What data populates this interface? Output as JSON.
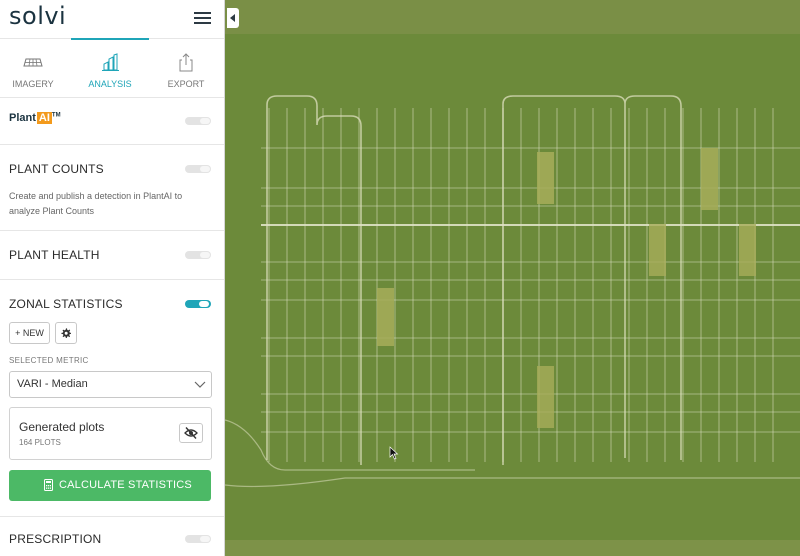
{
  "app": {
    "logo": "solvi"
  },
  "tabs": [
    {
      "label": "IMAGERY",
      "icon": "imagery-icon",
      "active": false
    },
    {
      "label": "ANALYSIS",
      "icon": "analysis-icon",
      "active": true
    },
    {
      "label": "EXPORT",
      "icon": "export-icon",
      "active": false
    }
  ],
  "plantai": {
    "brand": "Plant",
    "brand_ai": "AI",
    "trademark": "TM",
    "enabled": false
  },
  "plant_counts": {
    "title": "PLANT COUNTS",
    "description": "Create and publish a detection in PlantAI to analyze Plant Counts",
    "enabled": false
  },
  "plant_health": {
    "title": "PLANT HEALTH",
    "enabled": false
  },
  "zonal_statistics": {
    "title": "ZONAL STATISTICS",
    "enabled": true,
    "new_label": "+ NEW",
    "metric_label": "SELECTED METRIC",
    "metric_value": "VARI - Median",
    "plots_title": "Generated plots",
    "plots_count": "164 PLOTS",
    "calculate_label": "CALCULATE STATISTICS"
  },
  "prescription": {
    "title": "PRESCRIPTION",
    "enabled": false
  },
  "colors": {
    "accent": "#1fa5b8",
    "primary_button": "#4cb966",
    "brand_ai": "#f39a1c",
    "field": "#6f8a3c"
  }
}
